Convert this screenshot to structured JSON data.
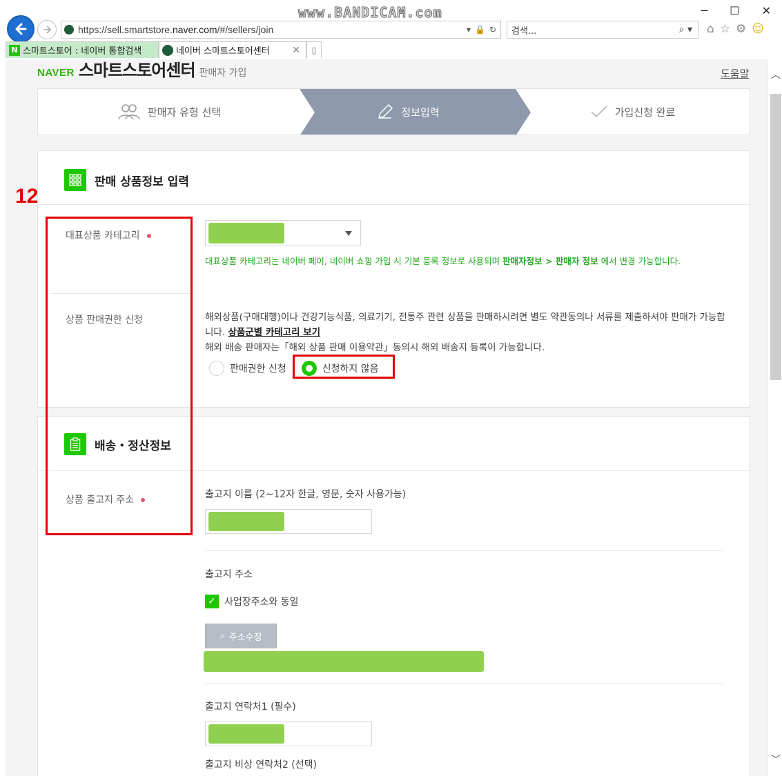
{
  "browser": {
    "url_prefix": "https://sell.smartstore.",
    "url_host": "naver.com",
    "url_path": "/#/sellers/join",
    "search_placeholder": "검색...",
    "watermark": "www.BANDICAM.com",
    "tabs": [
      {
        "label": "스마트스토어 : 네이버 통합검색"
      },
      {
        "label": "네이버 스마트스토어센터"
      }
    ]
  },
  "header": {
    "brand": "NAVER",
    "title": "스마트스토어센터",
    "subtitle": "판매자 가입",
    "help": "도움말"
  },
  "steps": [
    {
      "label": "판매자 유형 선택"
    },
    {
      "label": "정보입력"
    },
    {
      "label": "가입신청 완료"
    }
  ],
  "annotation": "12.",
  "section1": {
    "title": "판매 상품정보 입력",
    "category_label": "대표상품 카테고리",
    "category_note_1": "대표상품 카테고리는 네이버 페이, 네이버 쇼핑 가입 시 기본 등록 정보로 사용되며 ",
    "category_note_bold": "판매자정보 > 판매자 정보",
    "category_note_2": " 에서 변경 가능합니다.",
    "permission_label": "상품 판매권한 신청",
    "permission_desc_1": "해외상품(구매대행)이나 건강기능식품, 의료기기, 전통주 관련 상품을 판매하시려면 별도 약관동의나 서류를 제출하셔야 판매가 가능합니다. ",
    "permission_link": "상품군별 카테고리 보기",
    "permission_desc_2": "해외 배송 판매자는「해외 상품 판매 이용약관」동의시 해외 배송지 등록이 가능합니다.",
    "radio_apply": "판매권한 신청",
    "radio_not_apply": "신청하지 않음"
  },
  "section2": {
    "title": "배송・정산정보",
    "address_label": "상품 출고지 주소",
    "name_field_label": "출고지 이름 (2~12자 한글, 영문, 숫자 사용가능)",
    "address_field_label": "출고지 주소",
    "same_as_business": "사업장주소와 동일",
    "address_edit_btn": "주소수정",
    "contact1_label": "출고지 연락처1 (필수)",
    "contact2_label": "출고지 비상 연락처2 (선택)"
  }
}
